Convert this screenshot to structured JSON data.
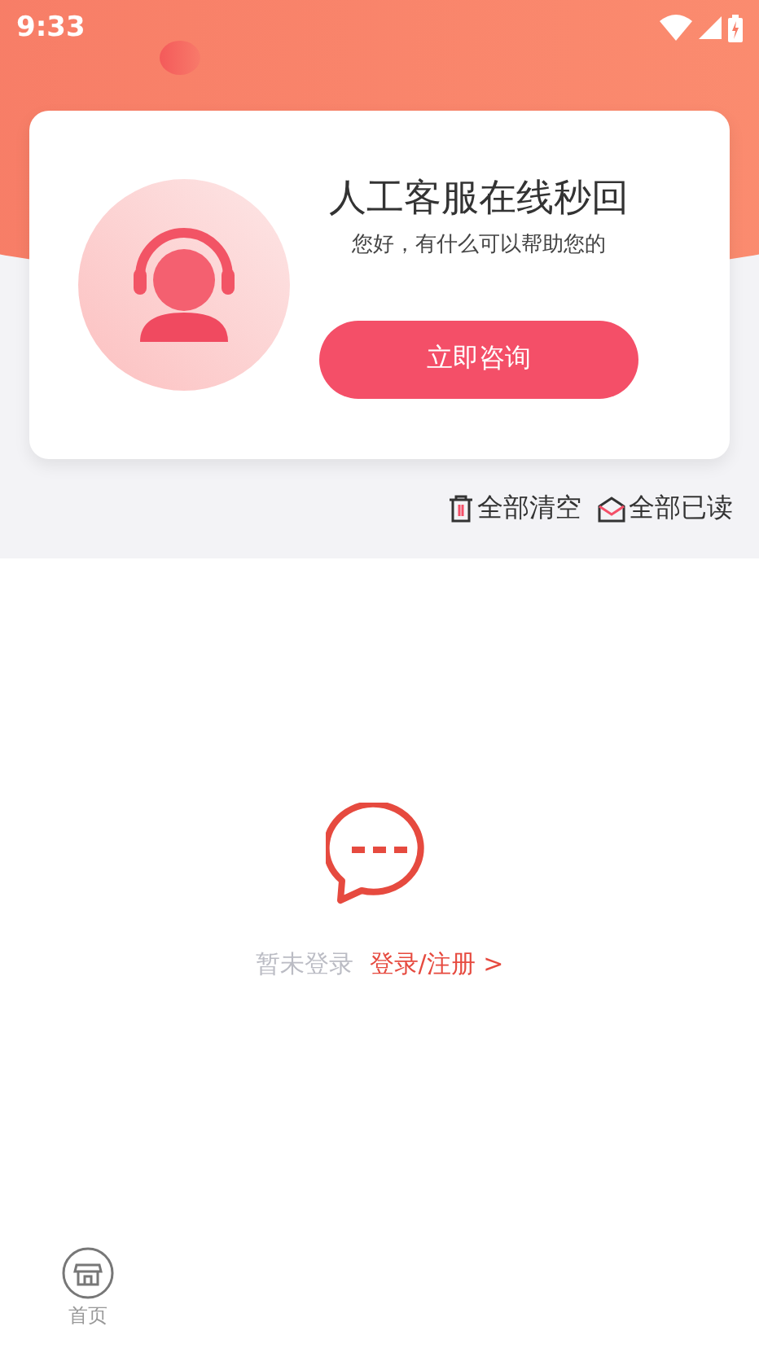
{
  "status_bar": {
    "time": "9:33"
  },
  "service_card": {
    "title": "人工客服在线秒回",
    "subtitle": "您好，有什么可以帮助您的",
    "button": "立即咨询"
  },
  "actions": [
    {
      "kind": "clear",
      "label": "全部清空"
    },
    {
      "kind": "read",
      "label": "全部已读"
    }
  ],
  "empty_state": {
    "hint": "暂未登录",
    "link": "登录/注册 >"
  },
  "bottom_nav": [
    {
      "label": "首页",
      "selected": false
    }
  ]
}
